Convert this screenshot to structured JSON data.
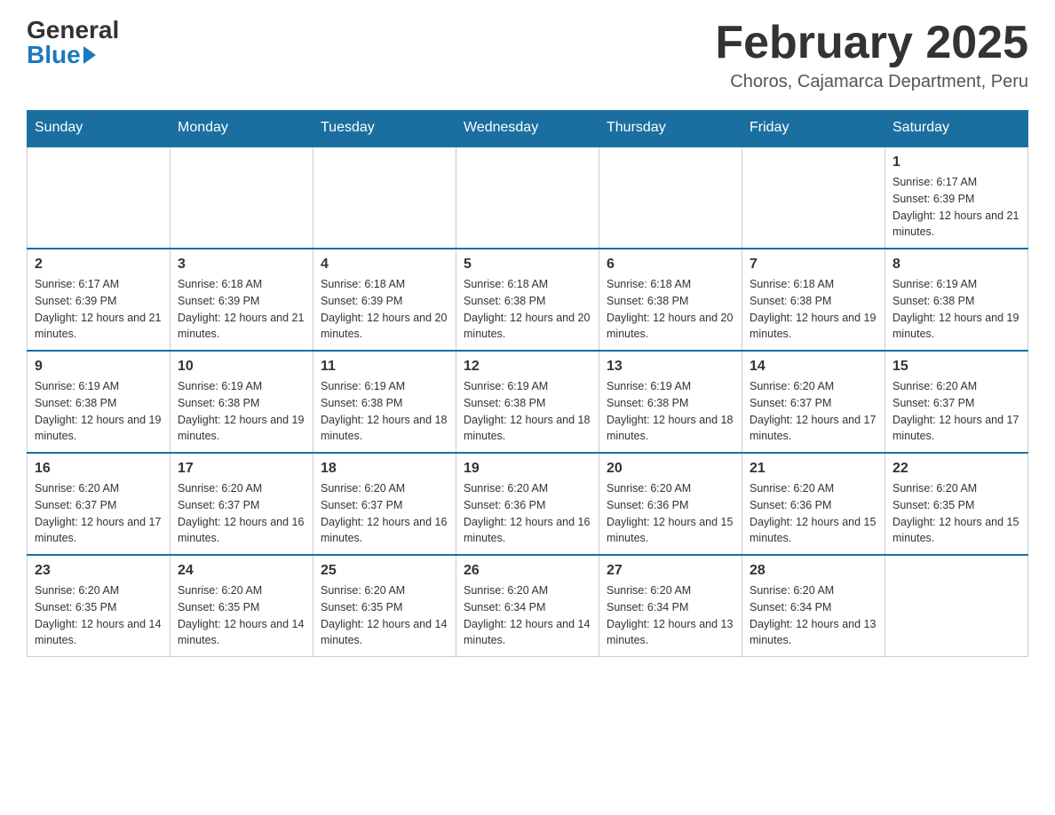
{
  "logo": {
    "general": "General",
    "blue": "Blue"
  },
  "title": "February 2025",
  "location": "Choros, Cajamarca Department, Peru",
  "days_of_week": [
    "Sunday",
    "Monday",
    "Tuesday",
    "Wednesday",
    "Thursday",
    "Friday",
    "Saturday"
  ],
  "weeks": [
    [
      {
        "day": "",
        "info": ""
      },
      {
        "day": "",
        "info": ""
      },
      {
        "day": "",
        "info": ""
      },
      {
        "day": "",
        "info": ""
      },
      {
        "day": "",
        "info": ""
      },
      {
        "day": "",
        "info": ""
      },
      {
        "day": "1",
        "info": "Sunrise: 6:17 AM\nSunset: 6:39 PM\nDaylight: 12 hours and 21 minutes."
      }
    ],
    [
      {
        "day": "2",
        "info": "Sunrise: 6:17 AM\nSunset: 6:39 PM\nDaylight: 12 hours and 21 minutes."
      },
      {
        "day": "3",
        "info": "Sunrise: 6:18 AM\nSunset: 6:39 PM\nDaylight: 12 hours and 21 minutes."
      },
      {
        "day": "4",
        "info": "Sunrise: 6:18 AM\nSunset: 6:39 PM\nDaylight: 12 hours and 20 minutes."
      },
      {
        "day": "5",
        "info": "Sunrise: 6:18 AM\nSunset: 6:38 PM\nDaylight: 12 hours and 20 minutes."
      },
      {
        "day": "6",
        "info": "Sunrise: 6:18 AM\nSunset: 6:38 PM\nDaylight: 12 hours and 20 minutes."
      },
      {
        "day": "7",
        "info": "Sunrise: 6:18 AM\nSunset: 6:38 PM\nDaylight: 12 hours and 19 minutes."
      },
      {
        "day": "8",
        "info": "Sunrise: 6:19 AM\nSunset: 6:38 PM\nDaylight: 12 hours and 19 minutes."
      }
    ],
    [
      {
        "day": "9",
        "info": "Sunrise: 6:19 AM\nSunset: 6:38 PM\nDaylight: 12 hours and 19 minutes."
      },
      {
        "day": "10",
        "info": "Sunrise: 6:19 AM\nSunset: 6:38 PM\nDaylight: 12 hours and 19 minutes."
      },
      {
        "day": "11",
        "info": "Sunrise: 6:19 AM\nSunset: 6:38 PM\nDaylight: 12 hours and 18 minutes."
      },
      {
        "day": "12",
        "info": "Sunrise: 6:19 AM\nSunset: 6:38 PM\nDaylight: 12 hours and 18 minutes."
      },
      {
        "day": "13",
        "info": "Sunrise: 6:19 AM\nSunset: 6:38 PM\nDaylight: 12 hours and 18 minutes."
      },
      {
        "day": "14",
        "info": "Sunrise: 6:20 AM\nSunset: 6:37 PM\nDaylight: 12 hours and 17 minutes."
      },
      {
        "day": "15",
        "info": "Sunrise: 6:20 AM\nSunset: 6:37 PM\nDaylight: 12 hours and 17 minutes."
      }
    ],
    [
      {
        "day": "16",
        "info": "Sunrise: 6:20 AM\nSunset: 6:37 PM\nDaylight: 12 hours and 17 minutes."
      },
      {
        "day": "17",
        "info": "Sunrise: 6:20 AM\nSunset: 6:37 PM\nDaylight: 12 hours and 16 minutes."
      },
      {
        "day": "18",
        "info": "Sunrise: 6:20 AM\nSunset: 6:37 PM\nDaylight: 12 hours and 16 minutes."
      },
      {
        "day": "19",
        "info": "Sunrise: 6:20 AM\nSunset: 6:36 PM\nDaylight: 12 hours and 16 minutes."
      },
      {
        "day": "20",
        "info": "Sunrise: 6:20 AM\nSunset: 6:36 PM\nDaylight: 12 hours and 15 minutes."
      },
      {
        "day": "21",
        "info": "Sunrise: 6:20 AM\nSunset: 6:36 PM\nDaylight: 12 hours and 15 minutes."
      },
      {
        "day": "22",
        "info": "Sunrise: 6:20 AM\nSunset: 6:35 PM\nDaylight: 12 hours and 15 minutes."
      }
    ],
    [
      {
        "day": "23",
        "info": "Sunrise: 6:20 AM\nSunset: 6:35 PM\nDaylight: 12 hours and 14 minutes."
      },
      {
        "day": "24",
        "info": "Sunrise: 6:20 AM\nSunset: 6:35 PM\nDaylight: 12 hours and 14 minutes."
      },
      {
        "day": "25",
        "info": "Sunrise: 6:20 AM\nSunset: 6:35 PM\nDaylight: 12 hours and 14 minutes."
      },
      {
        "day": "26",
        "info": "Sunrise: 6:20 AM\nSunset: 6:34 PM\nDaylight: 12 hours and 14 minutes."
      },
      {
        "day": "27",
        "info": "Sunrise: 6:20 AM\nSunset: 6:34 PM\nDaylight: 12 hours and 13 minutes."
      },
      {
        "day": "28",
        "info": "Sunrise: 6:20 AM\nSunset: 6:34 PM\nDaylight: 12 hours and 13 minutes."
      },
      {
        "day": "",
        "info": ""
      }
    ]
  ]
}
